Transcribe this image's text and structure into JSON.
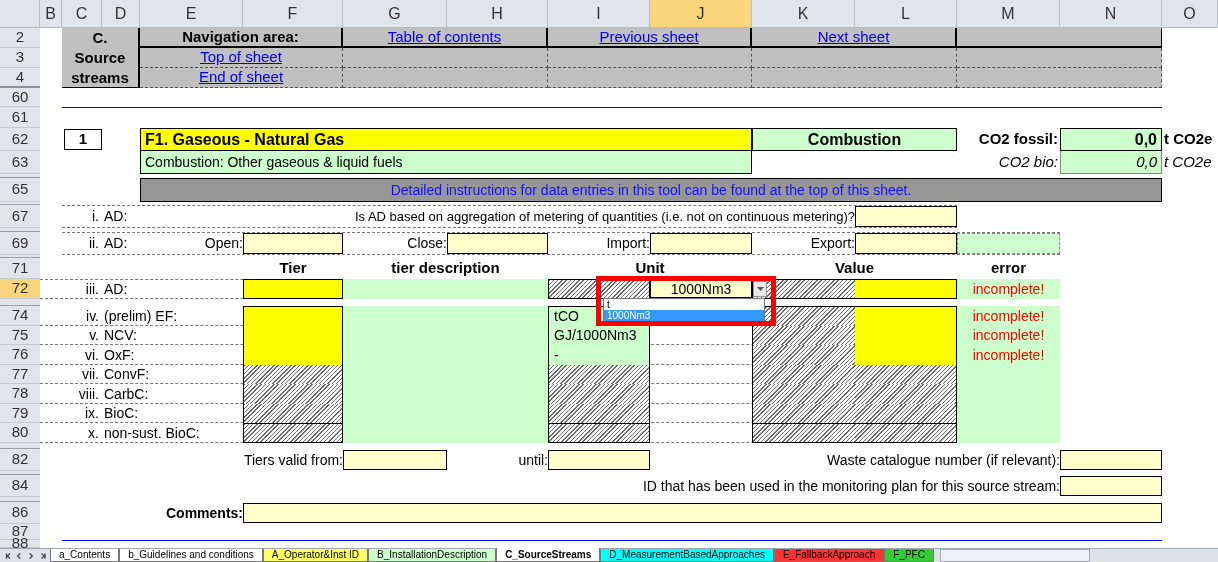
{
  "column_headers": [
    {
      "label": "B",
      "selected": false
    },
    {
      "label": "C",
      "selected": false
    },
    {
      "label": "D",
      "selected": false
    },
    {
      "label": "E",
      "selected": false
    },
    {
      "label": "F",
      "selected": false
    },
    {
      "label": "G",
      "selected": false
    },
    {
      "label": "H",
      "selected": false
    },
    {
      "label": "I",
      "selected": false
    },
    {
      "label": "J",
      "selected": true
    },
    {
      "label": "K",
      "selected": false
    },
    {
      "label": "L",
      "selected": false
    },
    {
      "label": "M",
      "selected": false
    },
    {
      "label": "N",
      "selected": false
    },
    {
      "label": "O",
      "selected": false
    }
  ],
  "row_headers": [
    {
      "label": "2",
      "selected": false
    },
    {
      "label": "3",
      "selected": false
    },
    {
      "label": "4",
      "selected": false
    },
    {
      "label": "60",
      "selected": false
    },
    {
      "label": "61",
      "selected": false
    },
    {
      "label": "62",
      "selected": false
    },
    {
      "label": "63",
      "selected": false
    },
    {
      "label": "65",
      "selected": false
    },
    {
      "label": "67",
      "selected": false
    },
    {
      "label": "69",
      "selected": false
    },
    {
      "label": "71",
      "selected": false
    },
    {
      "label": "72",
      "selected": true
    },
    {
      "label": "74",
      "selected": false
    },
    {
      "label": "75",
      "selected": false
    },
    {
      "label": "76",
      "selected": false
    },
    {
      "label": "77",
      "selected": false
    },
    {
      "label": "78",
      "selected": false
    },
    {
      "label": "79",
      "selected": false
    },
    {
      "label": "80",
      "selected": false
    },
    {
      "label": "82",
      "selected": false
    },
    {
      "label": "84",
      "selected": false
    },
    {
      "label": "86",
      "selected": false
    },
    {
      "label": "87",
      "selected": false
    },
    {
      "label": "88",
      "selected": false
    }
  ],
  "navigation": {
    "section_title": "C. Source streams",
    "title": "Navigation area:",
    "header_links": [
      "Table of contents",
      "Previous sheet",
      "Next sheet"
    ],
    "side_links": [
      "Top of sheet",
      "End of sheet"
    ]
  },
  "source_stream": {
    "number": "1",
    "name": "F1. Gaseous - Natural Gas",
    "category": "Combustion",
    "subtitle": "Combustion: Other gaseous & liquid fuels",
    "co2_fossil_label": "CO2 fossil:",
    "co2_fossil_value": "0,0",
    "co2_fossil_unit": "t CO2e",
    "co2_bio_label": "CO2 bio:",
    "co2_bio_value": "0,0",
    "co2_bio_unit": "t CO2e"
  },
  "instructions": "Detailed instructions for data entries in this tool can be found at the top of this sheet.",
  "aggregation": {
    "numeral": "i.",
    "label": "AD:",
    "question": "Is AD based on aggregation of metering of quantities (i.e. not on continuous metering)?"
  },
  "stock": {
    "numeral": "ii.",
    "label": "AD:",
    "fields": [
      "Open:",
      "Close:",
      "Import:",
      "Export:"
    ]
  },
  "table": {
    "columns": [
      "Tier",
      "tier description",
      "Unit",
      "Value",
      "error"
    ],
    "rows": [
      {
        "kind": "activity",
        "numeral": "iii.",
        "label": "AD:",
        "unit_selector": {
          "value": "1000Nm3",
          "expanded": true,
          "options": [
            {
              "label": "t",
              "selected": false
            },
            {
              "label": "1000Nm3",
              "selected": true
            }
          ]
        },
        "error": "incomplete!"
      },
      {
        "kind": "parameter",
        "numeral": "iv.",
        "label": "(prelim) EF:",
        "unit": "tCO",
        "error": "incomplete!"
      },
      {
        "kind": "parameter",
        "numeral": "v.",
        "label": "NCV:",
        "unit": "GJ/1000Nm3",
        "error": "incomplete!"
      },
      {
        "kind": "parameter",
        "numeral": "vi.",
        "label": "OxF:",
        "unit": "-",
        "error": "incomplete!"
      },
      {
        "kind": "unused",
        "numeral": "vii.",
        "label": "ConvF:"
      },
      {
        "kind": "unused",
        "numeral": "viii.",
        "label": "CarbC:"
      },
      {
        "kind": "unused",
        "numeral": "ix.",
        "label": "BioC:"
      },
      {
        "kind": "unused",
        "numeral": "x.",
        "label": "non-sust. BioC:"
      }
    ]
  },
  "tiers_valid": {
    "from_label": "Tiers valid from:",
    "until_label": "until:"
  },
  "waste_catalogue_label": "Waste catalogue number (if relevant):",
  "id_label": "ID that has been used in the monitoring plan for this source stream:",
  "comments_label": "Comments:",
  "sheet_tabs": [
    {
      "label": "a_Contents",
      "color": "#ffffff",
      "selected": false
    },
    {
      "label": "b_Guidelines and conditions",
      "color": "#ffffff",
      "selected": false
    },
    {
      "label": "A_Operator&Inst ID",
      "color": "#ffff66",
      "selected": false
    },
    {
      "label": "B_InstallationDescription",
      "color": "#ccffcc",
      "selected": false
    },
    {
      "label": "C_SourceStreams",
      "color": "#ffffff",
      "selected": true
    },
    {
      "label": "D_MeasurementBasedApproaches",
      "color": "#00ffff",
      "selected": false
    },
    {
      "label": "E_FallbackApproach",
      "color": "#ff3333",
      "selected": false
    },
    {
      "label": "F_PFC",
      "color": "#33cc33",
      "selected": false
    }
  ]
}
